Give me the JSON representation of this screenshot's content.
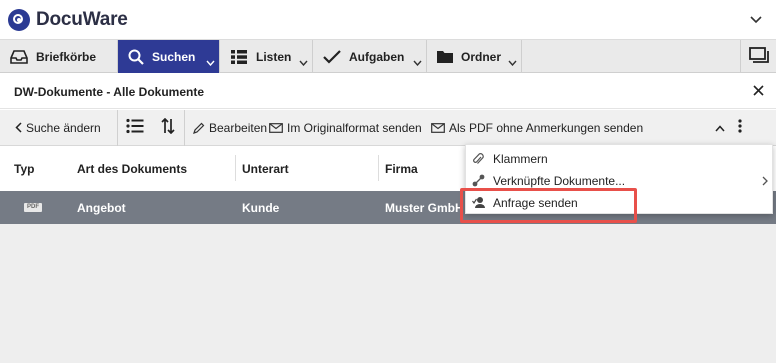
{
  "app": {
    "name": "DocuWare"
  },
  "nav": {
    "tabs": [
      {
        "label": "Briefkörbe",
        "icon": "inbox-icon"
      },
      {
        "label": "Suchen",
        "icon": "search-icon",
        "active": true
      },
      {
        "label": "Listen",
        "icon": "list-icon"
      },
      {
        "label": "Aufgaben",
        "icon": "checkmark-icon"
      },
      {
        "label": "Ordner",
        "icon": "folder-icon"
      }
    ]
  },
  "panel": {
    "title": "DW-Dokumente - Alle Dokumente"
  },
  "toolbar": {
    "back_label": "Suche ändern",
    "edit_label": "Bearbeiten",
    "send_original_label": "Im Originalformat senden",
    "send_pdf_label": "Als PDF ohne Anmerkungen senden"
  },
  "table": {
    "columns": [
      "Typ",
      "Art des Dokuments",
      "Unterart",
      "Firma"
    ],
    "rows": [
      {
        "type_icon": "PDF",
        "art": "Angebot",
        "unterart": "Kunde",
        "firma": "Muster GmbH"
      }
    ]
  },
  "context_menu": {
    "items": [
      {
        "label": "Klammern",
        "icon": "paperclip-icon"
      },
      {
        "label": "Verknüpfte Dokumente...",
        "icon": "linked-documents-icon",
        "has_submenu": true
      },
      {
        "label": "Anfrage senden",
        "icon": "send-request-icon",
        "highlighted": true
      }
    ]
  },
  "colors": {
    "accent": "#2e3a95",
    "selected_row": "#757b85",
    "highlight": "#e8504a"
  }
}
